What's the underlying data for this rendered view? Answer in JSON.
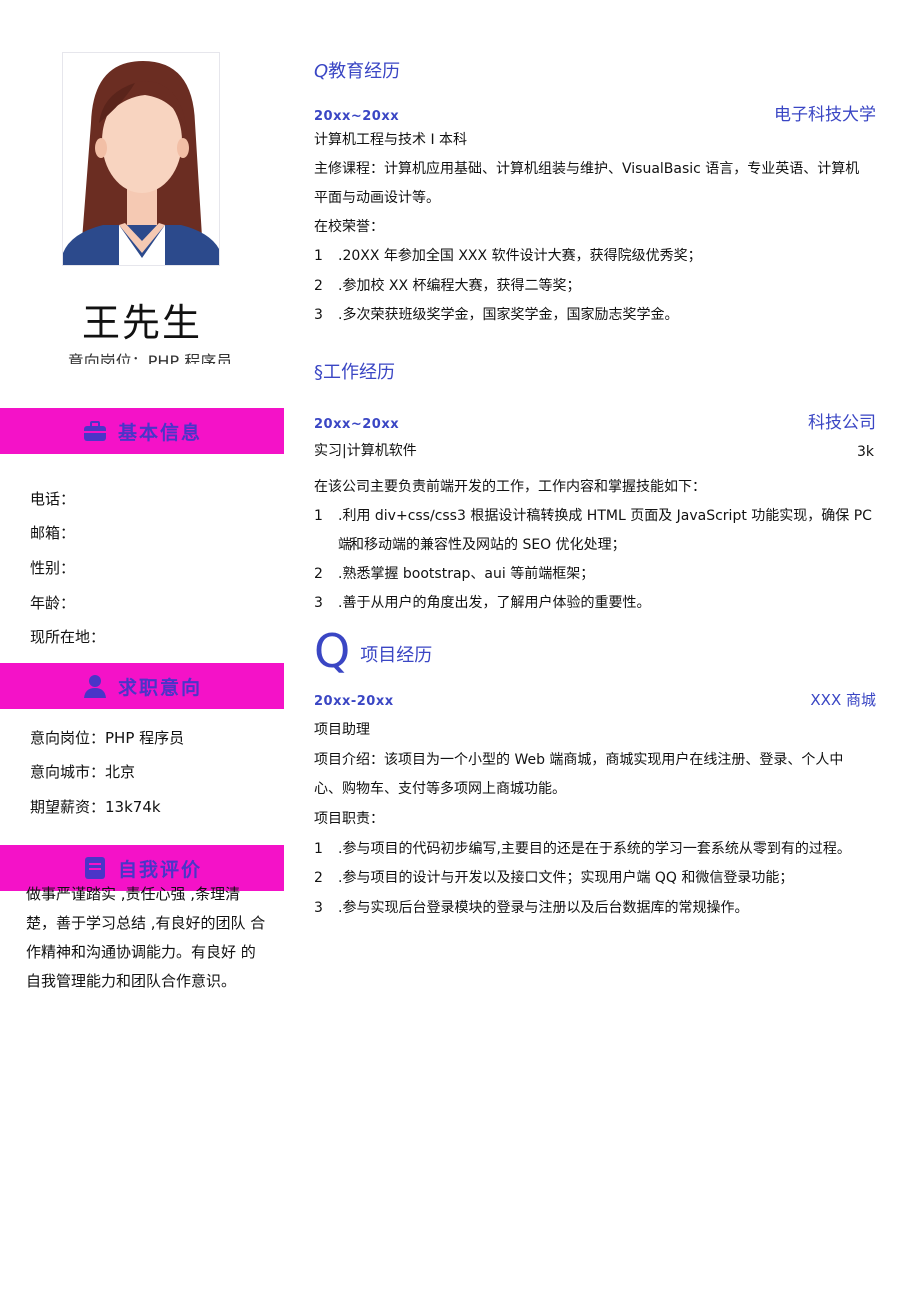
{
  "profile": {
    "name": "王先生",
    "subline": "意向岗位：PHP 程序员"
  },
  "sidebar": {
    "basic": {
      "title": "基本信息",
      "fields": [
        "电话：",
        "邮箱：",
        "性别：",
        "年龄：",
        "现所在地："
      ]
    },
    "intent": {
      "title": "求职意向",
      "fields": [
        "意向岗位：PHP 程序员",
        "意向城市：北京",
        "期望薪资：13k74k"
      ]
    },
    "self": {
      "title": "自我评价",
      "text": "做事严谨踏实 ,责任心强 ,条理清 楚，善于学习总结 ,有良好的团队 合作精神和沟通协调能力。有良好 的自我管理能力和团队合作意识。"
    }
  },
  "education": {
    "icon": "Q",
    "title": "教育经历",
    "date": "20xx~20xx",
    "school": "电子科技大学",
    "major": "计算机工程与技术 I 本科",
    "courses": "主修课程：计算机应用基础、计算机组装与维护、VisualBasic 语言，专业英语、计算机",
    "courses_cont": "平面与动画设计等。",
    "honors_title": "在校荣誉：",
    "honors": [
      {
        "num": "1",
        "text": ".20XX 年参加全国 XXX 软件设计大赛，获得院级优秀奖；"
      },
      {
        "num": "2",
        "text": ".参加校 XX 杯编程大赛，获得二等奖；"
      },
      {
        "num": "3",
        "text": ".多次荣获班级奖学金，国家奖学金，国家励志奖学金。"
      }
    ]
  },
  "work": {
    "icon": "§",
    "title": "工作经历",
    "date": "20xx~20xx",
    "company": "科技公司",
    "role": "实习|计算机软件",
    "salary": "3k",
    "intro": "在该公司主要负责前端开发的工作，工作内容和掌握技能如下：",
    "items": [
      {
        "num": "1",
        "text": ".利用 div+css∕css3 根据设计稿转换成 HTML 页面及 JavaScript 功能实现，确保 PC 端"
      },
      {
        "num": "2",
        "text": ".熟悉掌握 bootstrap、aui 等前端框架；"
      },
      {
        "num": "3",
        "text": ".善于从用户的角度出发，了解用户体验的重要性。"
      }
    ],
    "item1_cont": "和移动端的兼容性及网站的 SEO 优化处理；"
  },
  "project": {
    "icon": "Q",
    "title": "项目经历",
    "date": "20xx-20xx",
    "name": "XXX 商城",
    "role": "项目助理",
    "intro": "项目介绍：该项目为一个小型的 Web 端商城，商城实现用户在线注册、登录、个人中",
    "intro_cont": "心、购物车、支付等多项网上商城功能。",
    "duties_title": "项目职责：",
    "items": [
      {
        "num": "1",
        "text": ".参与项目的代码初步编写,主要目的还是在于系统的学习一套系统从零到有的过程。"
      },
      {
        "num": "2",
        "text": ".参与项目的设计与开发以及接口文件；实现用户端 QQ 和微信登录功能；"
      },
      {
        "num": "3",
        "text": ".参与实现后台登录模块的登录与注册以及后台数据库的常规操作。"
      }
    ]
  },
  "colors": {
    "accent": "#3a46c4",
    "bar": "#f412c8",
    "bar_text": "#4a35c8"
  }
}
